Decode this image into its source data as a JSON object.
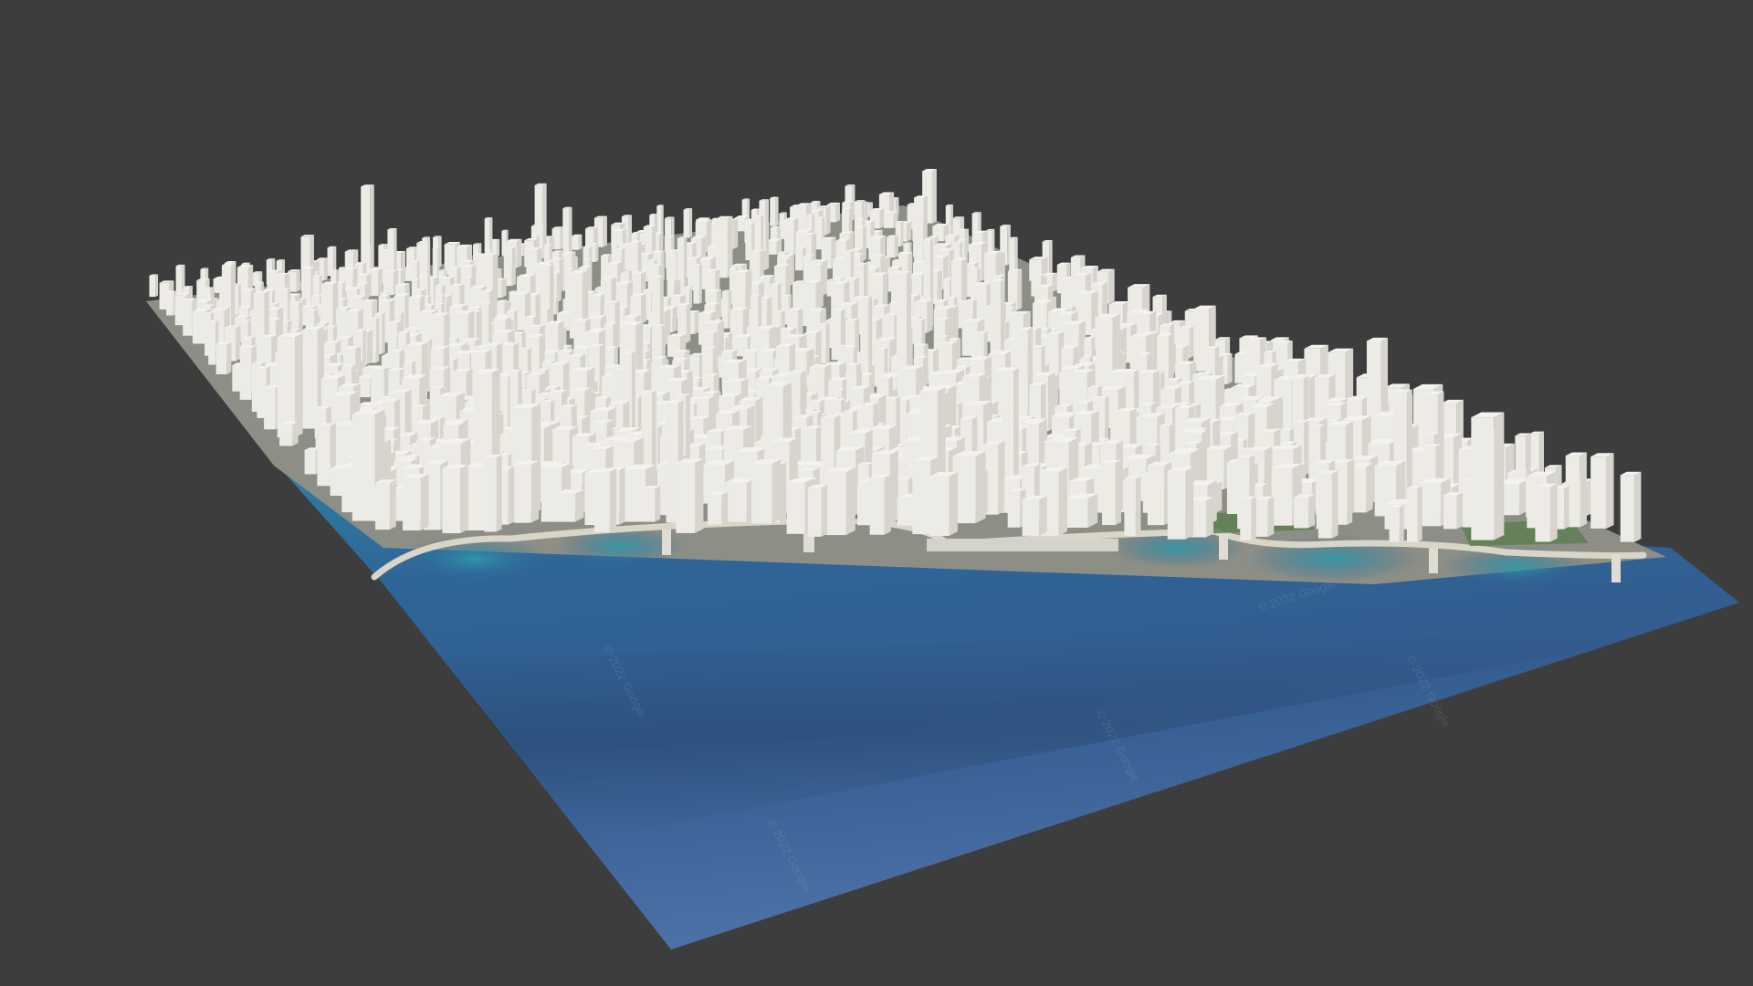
{
  "viewport": {
    "background": "#3d3d3d"
  },
  "scene": {
    "water_color": "#2f5f96",
    "shallow_water_color": "#2f8aa0",
    "building_color": "#ecebe6",
    "building_shade": "#d6d4cd",
    "park_color": "#5d7f52",
    "beach_color": "#d9d6c8"
  },
  "watermarks": [
    "© 2022 Google",
    "© 2022 Google",
    "© 2022 Google",
    "© 2022 Google",
    "© 2022 Google"
  ]
}
